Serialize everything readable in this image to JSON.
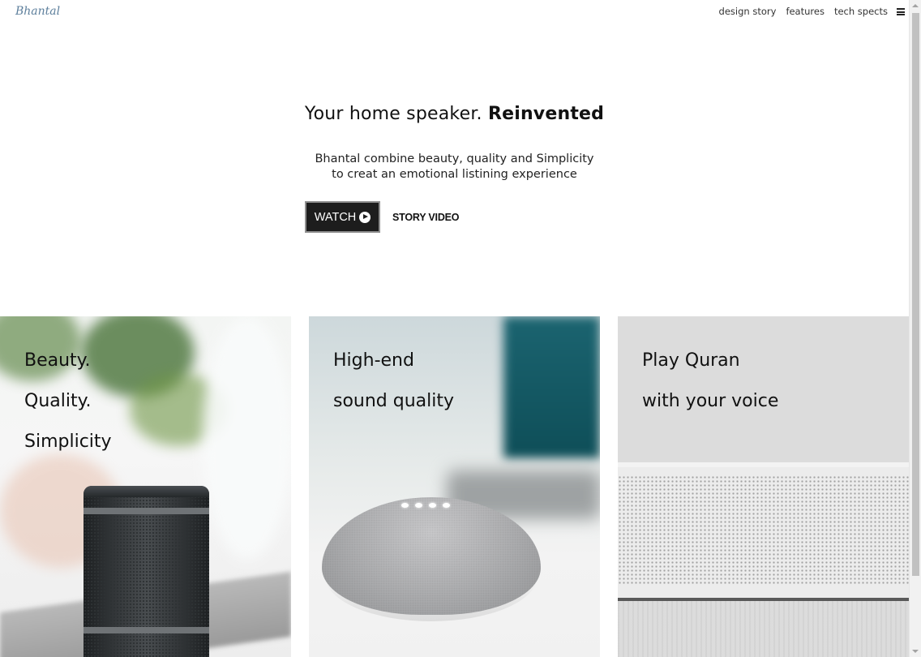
{
  "brand": {
    "logo_text": "Bhantal"
  },
  "nav": {
    "items": [
      {
        "label": "design story"
      },
      {
        "label": "features"
      },
      {
        "label": "tech spects"
      }
    ],
    "menu_icon": "hamburger-menu-icon"
  },
  "hero": {
    "title_prefix": "Your home speaker. ",
    "title_emphasis": "Reinvented",
    "subtitle_line1": "Bhantal combine beauty, quality and Simplicity",
    "subtitle_line2": "to creat an emotional listining experience",
    "watch_label": "WATCH",
    "watch_icon": "play-circle-icon",
    "story_label": "STORY VIDEO"
  },
  "cards": [
    {
      "lines": [
        "Beauty.",
        "Quality.",
        "Simplicity"
      ],
      "image": "black-portable-speaker-photo"
    },
    {
      "lines": [
        "High-end",
        "sound quality"
      ],
      "image": "grey-smart-speaker-dome-photo"
    },
    {
      "lines": [
        "Play Quran",
        "with your voice"
      ],
      "image": "white-soundbar-photo"
    }
  ],
  "colors": {
    "logo": "#5d7f9c",
    "button_bg": "#1d1d1d",
    "button_text": "#ffffff",
    "text": "#111111"
  }
}
